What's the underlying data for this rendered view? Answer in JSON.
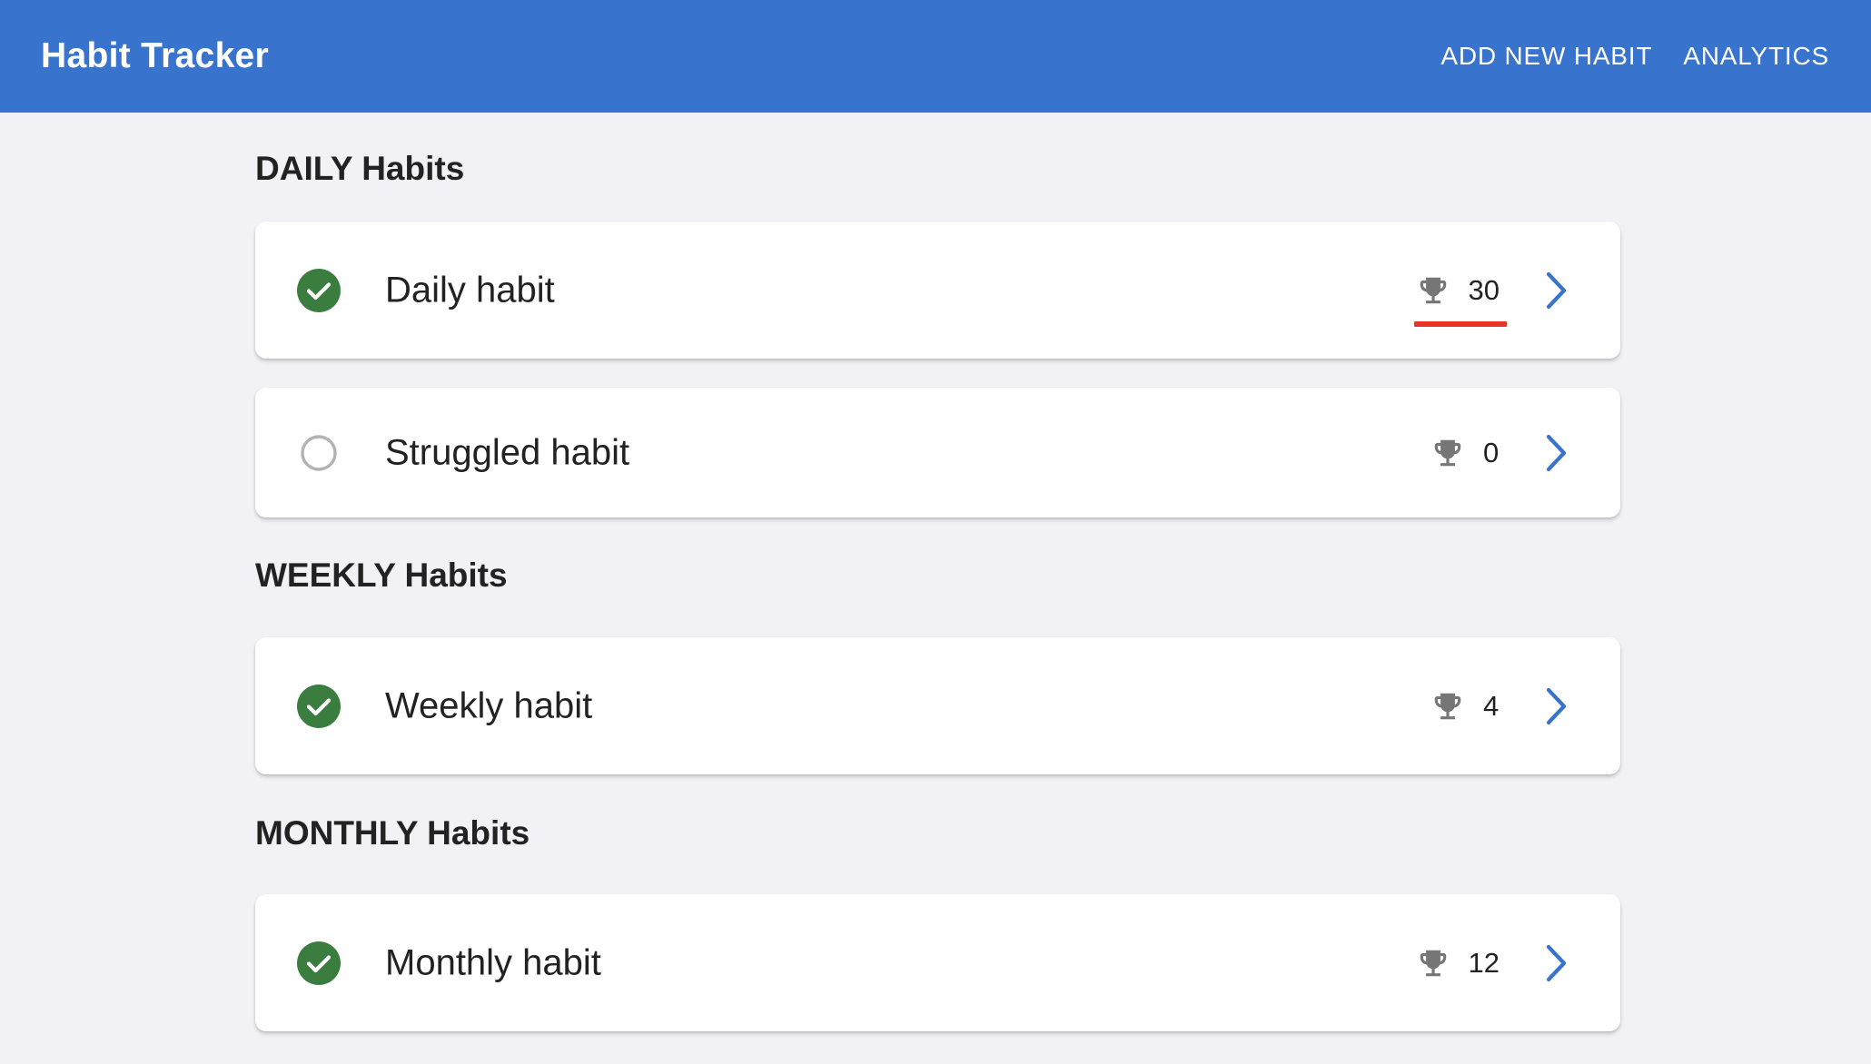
{
  "app": {
    "title": "Habit Tracker",
    "nav": [
      {
        "label": "ADD NEW HABIT"
      },
      {
        "label": "ANALYTICS"
      }
    ]
  },
  "colors": {
    "primary": "#3874ce",
    "done": "#3a7d3f",
    "highlight": "#e53525"
  },
  "sections": [
    {
      "title": "DAILY Habits",
      "habits": [
        {
          "name": "Daily habit",
          "done": true,
          "streak": "30",
          "highlighted": true
        },
        {
          "name": "Struggled habit",
          "done": false,
          "streak": "0"
        }
      ]
    },
    {
      "title": "WEEKLY Habits",
      "habits": [
        {
          "name": "Weekly habit",
          "done": true,
          "streak": "4"
        }
      ]
    },
    {
      "title": "MONTHLY Habits",
      "habits": [
        {
          "name": "Monthly habit",
          "done": true,
          "streak": "12"
        }
      ]
    }
  ]
}
